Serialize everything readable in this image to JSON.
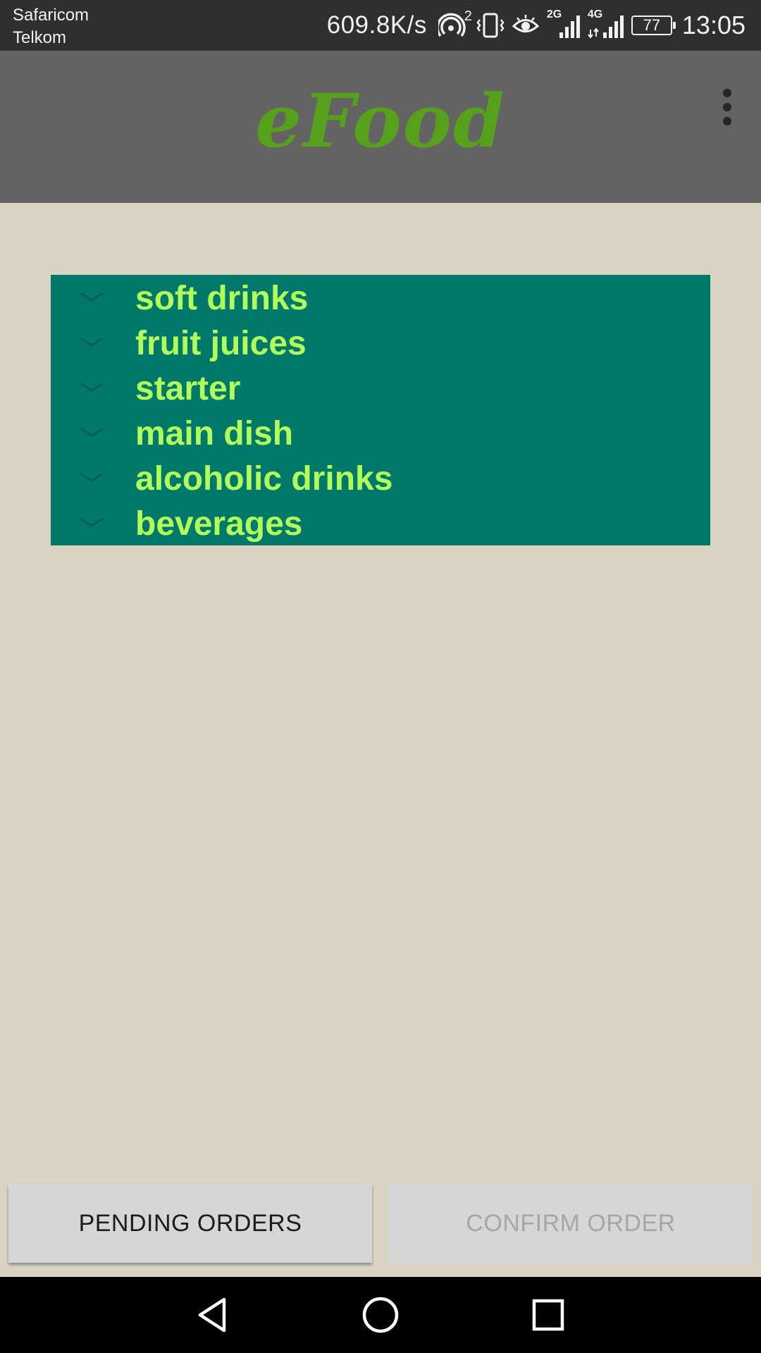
{
  "status_bar": {
    "carrier_1": "Safaricom",
    "carrier_2": "Telkom",
    "network_speed": "609.8K/s",
    "hotspot_count": "2",
    "network_1": "2G",
    "network_2": "4G",
    "battery": "77",
    "time": "13:05"
  },
  "app_bar": {
    "title": "eFood",
    "title_color": "#56a01c",
    "menu_icon": "more-vertical-icon"
  },
  "categories": [
    {
      "label": "soft drinks",
      "icon": "chevron-down-icon"
    },
    {
      "label": "fruit juices",
      "icon": "chevron-down-icon"
    },
    {
      "label": "starter",
      "icon": "chevron-down-icon"
    },
    {
      "label": "main dish",
      "icon": "chevron-down-icon"
    },
    {
      "label": "alcoholic drinks",
      "icon": "chevron-down-icon"
    },
    {
      "label": "beverages",
      "icon": "chevron-down-icon"
    }
  ],
  "colors": {
    "background": "#d9d4c2",
    "list_background": "#00796b",
    "list_text": "#b2ff59",
    "app_bar": "#636363"
  },
  "buttons": {
    "pending_orders": "PENDING ORDERS",
    "confirm_order": "CONFIRM ORDER",
    "confirm_enabled": false
  },
  "nav_bar": {
    "back": "back-icon",
    "home": "home-icon",
    "recents": "recents-icon"
  }
}
